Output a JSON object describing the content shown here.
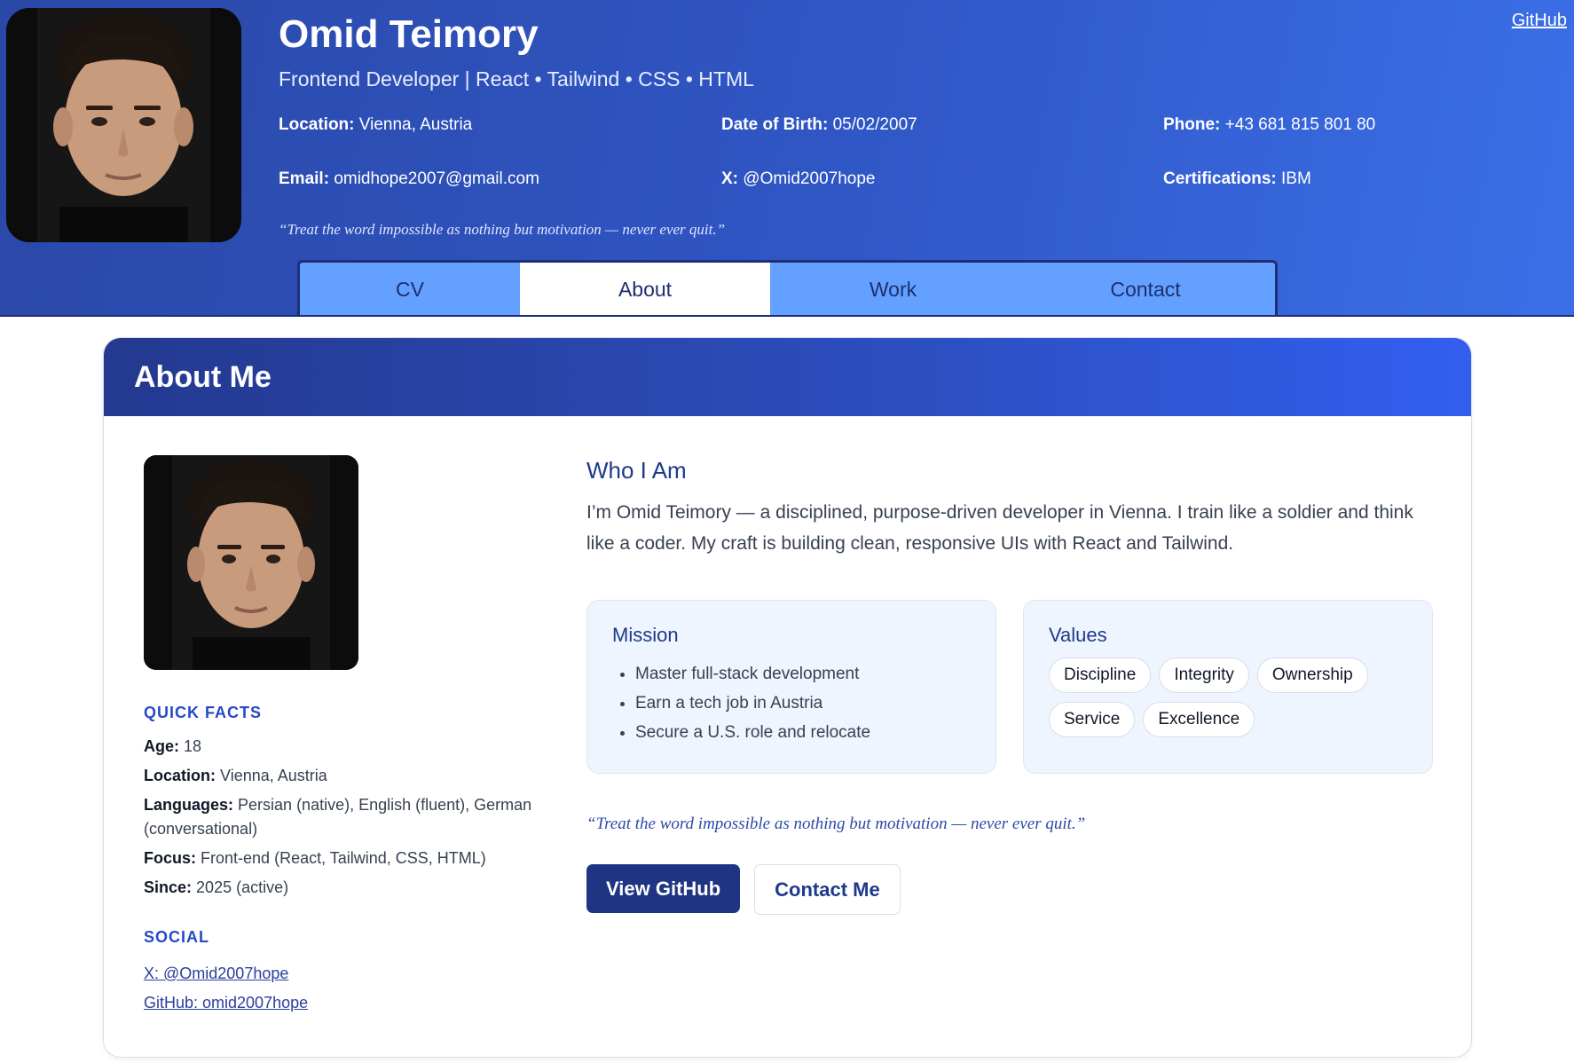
{
  "header": {
    "github_link": "GitHub",
    "name": "Omid Teimory",
    "tagline": "Frontend Developer | React • Tailwind • CSS • HTML",
    "info": [
      {
        "label": "Location:",
        "value": "Vienna, Austria"
      },
      {
        "label": "Date of Birth:",
        "value": "05/02/2007"
      },
      {
        "label": "Phone:",
        "value": "+43 681 815 801 80"
      },
      {
        "label": "Email:",
        "value": "omidhope2007@gmail.com"
      },
      {
        "label": "X:",
        "value": "@Omid2007hope"
      },
      {
        "label": "Certifications:",
        "value": "IBM"
      }
    ],
    "quote": "“Treat the word impossible as nothing but motivation — never ever quit.”"
  },
  "tabs": [
    {
      "label": "CV",
      "active": false
    },
    {
      "label": "About",
      "active": true
    },
    {
      "label": "Work",
      "active": false
    },
    {
      "label": "Contact",
      "active": false
    }
  ],
  "about": {
    "title": "About Me",
    "quick_facts_title": "QUICK FACTS",
    "facts": [
      {
        "label": "Age:",
        "value": "18"
      },
      {
        "label": "Location:",
        "value": "Vienna, Austria"
      },
      {
        "label": "Languages:",
        "value": "Persian (native), English (fluent), German (conversational)"
      },
      {
        "label": "Focus:",
        "value": "Front-end (React, Tailwind, CSS, HTML)"
      },
      {
        "label": "Since:",
        "value": "2025 (active)"
      }
    ],
    "social_title": "SOCIAL",
    "social": [
      "X: @Omid2007hope",
      "GitHub: omid2007hope"
    ],
    "who_title": "Who I Am",
    "who_text": "I’m Omid Teimory — a disciplined, purpose-driven developer in Vienna. I train like a soldier and think like a coder. My craft is building clean, responsive UIs with React and Tailwind.",
    "mission_title": "Mission",
    "mission": [
      "Master full-stack development",
      "Earn a tech job in Austria",
      "Secure a U.S. role and relocate"
    ],
    "values_title": "Values",
    "values": [
      "Discipline",
      "Integrity",
      "Ownership",
      "Service",
      "Excellence"
    ],
    "quote": "“Treat the word impossible as nothing but motivation — never ever quit.”",
    "view_github": "View GitHub",
    "contact_me": "Contact Me"
  },
  "colors": {
    "header_gradient_start": "#2a48a8",
    "header_gradient_end": "#3b6fe8",
    "tab_background": "#63a0ff",
    "accent_dark": "#1f3584",
    "section_title": "#2748c9"
  }
}
